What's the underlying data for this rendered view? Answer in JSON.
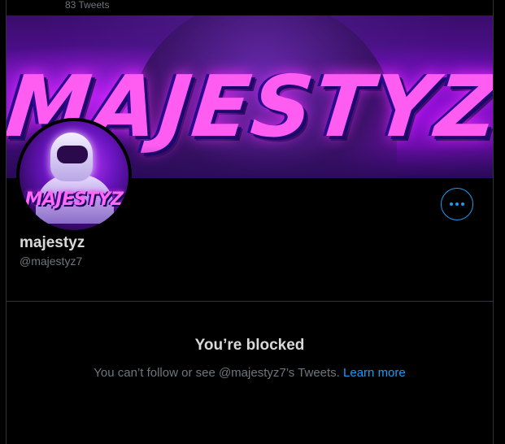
{
  "header": {
    "tweet_count": "83 Tweets"
  },
  "banner": {
    "art_text": "MAJESTYZ"
  },
  "avatar": {
    "art_text": "MAJESTYZ"
  },
  "profile": {
    "display_name": "majestyz",
    "handle": "@majestyz7",
    "more_icon": "more-horizontal-icon"
  },
  "blocked": {
    "title": "You’re blocked",
    "message": "You can’t follow or see @majestyz7’s Tweets.",
    "link_label": "Learn more"
  },
  "colors": {
    "background": "#000000",
    "accent": "#1d9bf0",
    "border": "#2f3336",
    "muted_text": "#6e767d",
    "primary_text": "#d9d9d9"
  }
}
